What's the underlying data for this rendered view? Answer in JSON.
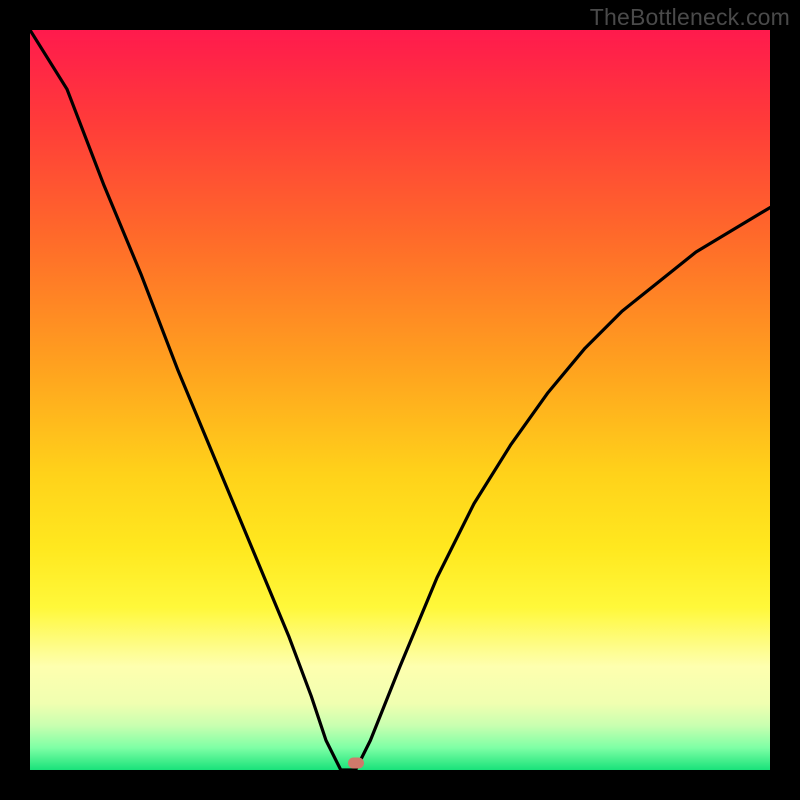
{
  "watermark": "TheBottleneck.com",
  "chart_data": {
    "type": "line",
    "title": "",
    "xlabel": "",
    "ylabel": "",
    "xlim": [
      0,
      100
    ],
    "ylim": [
      0,
      100
    ],
    "optimum_x": 42,
    "series": [
      {
        "name": "curve",
        "x": [
          0,
          5,
          10,
          15,
          20,
          25,
          30,
          35,
          38,
          40,
          42,
          44,
          46,
          50,
          55,
          60,
          65,
          70,
          75,
          80,
          85,
          90,
          95,
          100
        ],
        "y": [
          105,
          92,
          79,
          67,
          54,
          42,
          30,
          18,
          10,
          4,
          0,
          0,
          4,
          14,
          26,
          36,
          44,
          51,
          57,
          62,
          66,
          70,
          73,
          76
        ]
      }
    ],
    "marker": {
      "x": 44,
      "y": 1
    },
    "background": "rainbow-vertical"
  }
}
